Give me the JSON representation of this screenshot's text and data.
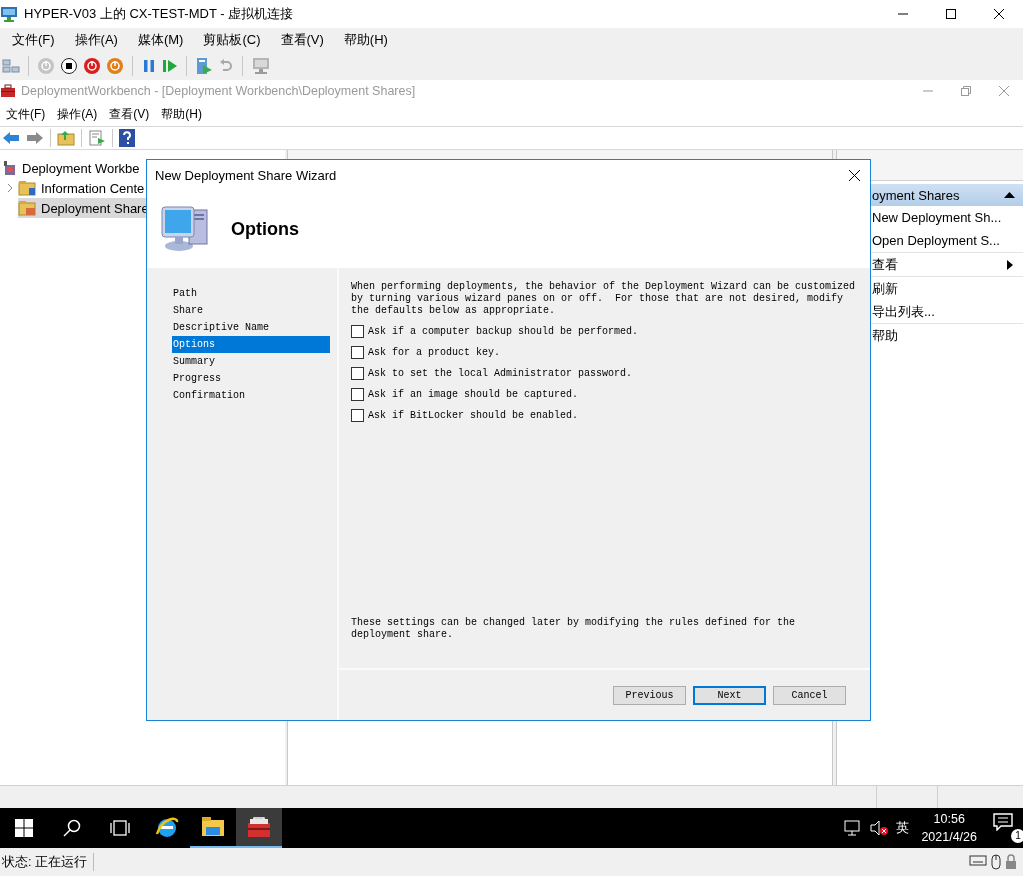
{
  "vm_window": {
    "title": "HYPER-V03 上的 CX-TEST-MDT - 虚拟机连接",
    "menu": [
      "文件(F)",
      "操作(A)",
      "媒体(M)",
      "剪贴板(C)",
      "查看(V)",
      "帮助(H)"
    ]
  },
  "mmc": {
    "title": "DeploymentWorkbench - [Deployment Workbench\\Deployment Shares]",
    "menu": [
      "文件(F)",
      "操作(A)",
      "查看(V)",
      "帮助(H)"
    ],
    "tree": [
      {
        "label": "Deployment Workbe",
        "selected": false,
        "children": [
          {
            "label": "Information Cente",
            "selected": false,
            "expanded": false
          },
          {
            "label": "Deployment Share",
            "selected": true
          }
        ]
      }
    ],
    "actions": {
      "header": "oyment Shares",
      "items": [
        {
          "label": "New Deployment Sh...",
          "kind": "command",
          "separator_after": false
        },
        {
          "label": "Open Deployment S...",
          "kind": "command",
          "separator_after": true
        },
        {
          "label": "查看",
          "kind": "submenu",
          "separator_after": true
        },
        {
          "label": "刷新",
          "kind": "command",
          "separator_after": false
        },
        {
          "label": "导出列表...",
          "kind": "command",
          "separator_after": true
        },
        {
          "label": "帮助",
          "kind": "command",
          "separator_after": false
        }
      ]
    }
  },
  "wizard": {
    "title": "New Deployment Share Wizard",
    "heading": "Options",
    "steps": [
      {
        "label": "Path",
        "selected": false
      },
      {
        "label": "Share",
        "selected": false
      },
      {
        "label": "Descriptive Name",
        "selected": false
      },
      {
        "label": "Options",
        "selected": true
      },
      {
        "label": "Summary",
        "selected": false
      },
      {
        "label": "Progress",
        "selected": false
      },
      {
        "label": "Confirmation",
        "selected": false
      }
    ],
    "intro": "When performing deployments, the behavior of the Deployment Wizard can be customized by turning various wizard panes on or off.  For those that are not desired, modify the defaults below as appropriate.",
    "options": [
      {
        "label": "Ask if a computer backup should be performed.",
        "checked": false
      },
      {
        "label": "Ask for a product key.",
        "checked": false
      },
      {
        "label": "Ask to set the local Administrator password.",
        "checked": false
      },
      {
        "label": "Ask if an image should be captured.",
        "checked": false
      },
      {
        "label": "Ask if BitLocker should be enabled.",
        "checked": false
      }
    ],
    "note": "These settings can be changed later by modifying the rules defined for the deployment share.",
    "buttons": [
      {
        "label": "Previous",
        "default": false
      },
      {
        "label": "Next",
        "default": true
      },
      {
        "label": "Cancel",
        "default": false
      }
    ]
  },
  "taskbar": {
    "apps": [
      {
        "kind": "browser",
        "running": false,
        "selected": false
      },
      {
        "kind": "files",
        "running": true,
        "selected": false
      },
      {
        "kind": "toolbox",
        "running": true,
        "selected": true
      }
    ],
    "tray": {
      "language": "英",
      "time": "10:56",
      "date": "2021/4/26",
      "notifications": "1",
      "volume_muted": true
    }
  },
  "status_bar": {
    "status": "状态: 正在运行"
  }
}
